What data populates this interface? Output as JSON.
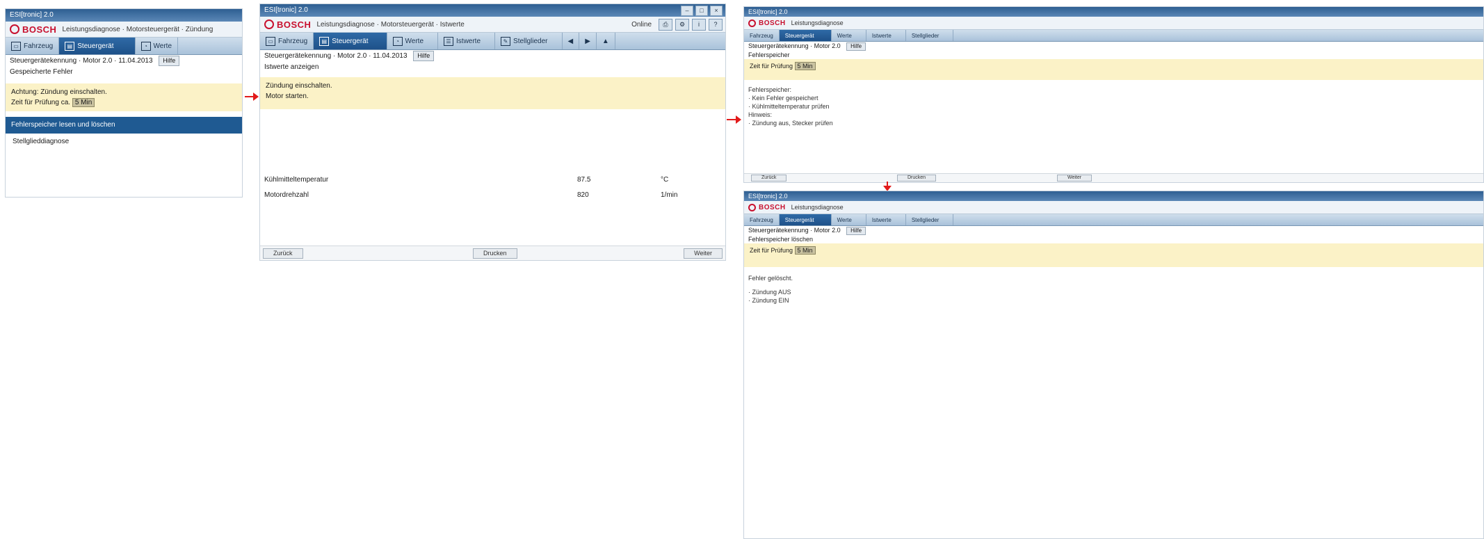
{
  "colors": {
    "accent_blue": "#1f5a92",
    "info_yellow": "#fbf2c7",
    "brand_red": "#c8102e",
    "arrow_red": "#e21b1b"
  },
  "window_controls": [
    "–",
    "□",
    "×"
  ],
  "screen1": {
    "title": "ESI[tronic] 2.0",
    "brand": "BOSCH",
    "crumb": "Leistungsdiagnose · Motorsteuergerät · Zündung",
    "tabs": [
      {
        "label": "Fahrzeug",
        "icon": "car-icon"
      },
      {
        "label": "Steuergerät",
        "icon": "ecu-icon"
      },
      {
        "label": "Werte",
        "icon": "gauge-icon"
      }
    ],
    "info": "Steuergerätekennung · Motor 2.0 · 11.04.2013",
    "info_button": "Hilfe",
    "section": "Gespeicherte Fehler",
    "notice_line1": "Achtung: Zündung einschalten.",
    "notice_line2": "Zeit für Prüfung ca.",
    "notice_highlight": "5 Min",
    "selected_item": "Fehlerspeicher lesen und löschen",
    "second_item": "Stellglieddiagnose"
  },
  "screen2": {
    "title": "ESI[tronic] 2.0",
    "brand": "BOSCH",
    "crumb": "Leistungsdiagnose · Motorsteuergerät · Istwerte",
    "status_label": "Online",
    "tabs": [
      {
        "label": "Fahrzeug",
        "icon": "car-icon"
      },
      {
        "label": "Steuergerät",
        "icon": "ecu-icon"
      },
      {
        "label": "Werte",
        "icon": "gauge-icon"
      },
      {
        "label": "Istwerte",
        "icon": "list-icon"
      },
      {
        "label": "Stellglieder",
        "icon": "wrench-icon"
      }
    ],
    "info": "Steuergerätekennung · Motor 2.0 · 11.04.2013",
    "info_button": "Hilfe",
    "section": "Istwerte anzeigen",
    "notice_line1": "Zündung einschalten.",
    "notice_line2": "Motor starten.",
    "rows": [
      {
        "name": "Kühlmitteltemperatur",
        "value": "87.5",
        "unit": "°C"
      },
      {
        "name": "Motordrehzahl",
        "value": "820",
        "unit": "1/min"
      }
    ],
    "buttons": {
      "back": "Zurück",
      "middle": "Drucken",
      "next": "Weiter"
    }
  },
  "screen3": {
    "title": "ESI[tronic] 2.0",
    "brand": "BOSCH",
    "crumb": "Leistungsdiagnose",
    "tabs": [
      "Fahrzeug",
      "Steuergerät",
      "Werte",
      "Istwerte",
      "Stellglieder"
    ],
    "info": "Steuergerätekennung · Motor 2.0",
    "info_button": "Hilfe",
    "section": "Fehlerspeicher",
    "notice": "Zeit für Prüfung",
    "notice_highlight": "5 Min",
    "detail_lines": [
      "Fehlerspeicher:",
      "· Kein Fehler gespeichert",
      "· Kühlmitteltemperatur prüfen",
      "Hinweis:",
      "· Zündung aus, Stecker prüfen"
    ],
    "bottom_buttons": [
      "Zurück",
      "Drucken",
      "Weiter"
    ]
  },
  "screen4": {
    "title": "ESI[tronic] 2.0",
    "brand": "BOSCH",
    "crumb": "Leistungsdiagnose",
    "tabs": [
      "Fahrzeug",
      "Steuergerät",
      "Werte",
      "Istwerte",
      "Stellglieder"
    ],
    "info": "Steuergerätekennung · Motor 2.0",
    "info_button": "Hilfe",
    "section": "Fehlerspeicher löschen",
    "notice": "Zeit für Prüfung",
    "notice_highlight": "5 Min",
    "detail_title": "Fehler gelöscht.",
    "detail_lines": [
      "· Zündung AUS",
      "· Zündung EIN"
    ]
  }
}
